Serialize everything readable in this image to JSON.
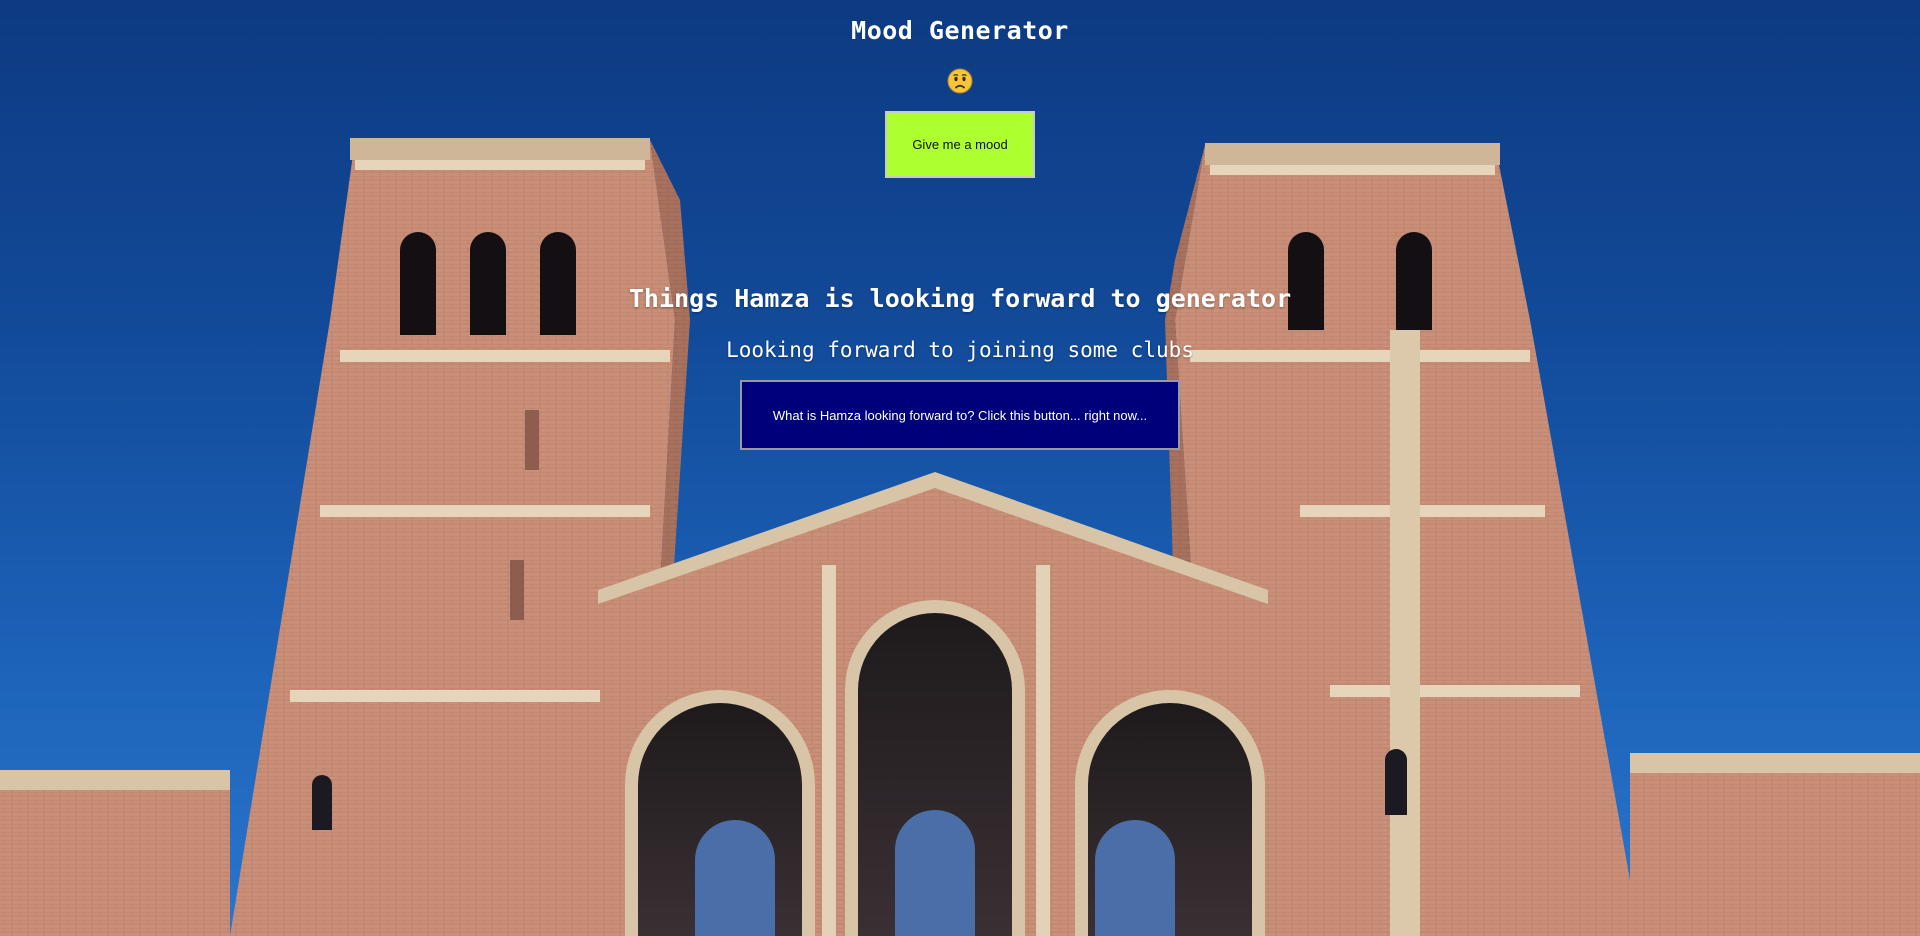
{
  "page": {
    "title": "Mood Generator",
    "mood_emoji": "worried-face-emoji",
    "mood_button_label": "Give me a mood",
    "forward_heading": "Things Hamza is looking forward to generator",
    "forward_text": "Looking forward to joining some clubs",
    "forward_button_label": "What is Hamza looking forward to? Click this button... right now..."
  },
  "background": {
    "description_icon": "building-background-image",
    "sky_color": "#124a99"
  },
  "colors": {
    "mood_button_bg": "#adff2f",
    "forward_button_bg": "#00007a",
    "text": "#ffffff"
  }
}
